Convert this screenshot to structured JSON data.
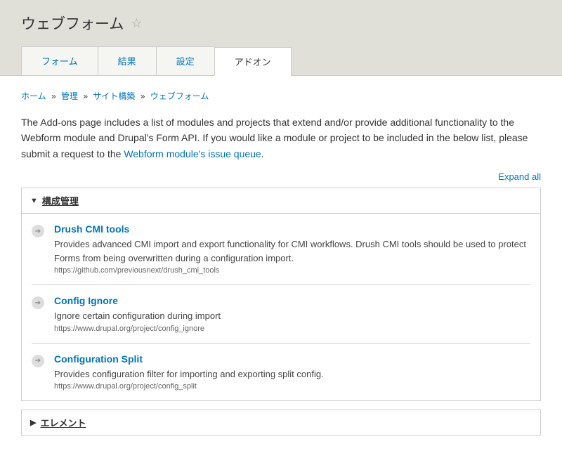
{
  "page_title": "ウェブフォーム",
  "tabs": [
    {
      "label": "フォーム"
    },
    {
      "label": "結果"
    },
    {
      "label": "設定"
    },
    {
      "label": "アドオン"
    }
  ],
  "breadcrumb": {
    "items": [
      "ホーム",
      "管理",
      "サイト構築",
      "ウェブフォーム"
    ],
    "sep": "»"
  },
  "intro": {
    "text_before": "The Add-ons page includes a list of modules and projects that extend and/or provide additional functionality to the Webform module and Drupal's Form API. If you would like a module or project to be included in the below list, please submit a request to the ",
    "link_text": "Webform module's issue queue",
    "text_after": "."
  },
  "expand_all": "Expand all",
  "sections": [
    {
      "label": "構成管理",
      "expanded": true,
      "items": [
        {
          "title": "Drush CMI tools",
          "desc": "Provides advanced CMI import and export functionality for CMI workflows. Drush CMI tools should be used to protect Forms from being overwritten during a configuration import.",
          "url": "https://github.com/previousnext/drush_cmi_tools"
        },
        {
          "title": "Config Ignore",
          "desc": "Ignore certain configuration during import",
          "url": "https://www.drupal.org/project/config_ignore"
        },
        {
          "title": "Configuration Split",
          "desc": "Provides configuration filter for importing and exporting split config.",
          "url": "https://www.drupal.org/project/config_split"
        }
      ]
    },
    {
      "label": "エレメント",
      "expanded": false,
      "items": []
    }
  ]
}
